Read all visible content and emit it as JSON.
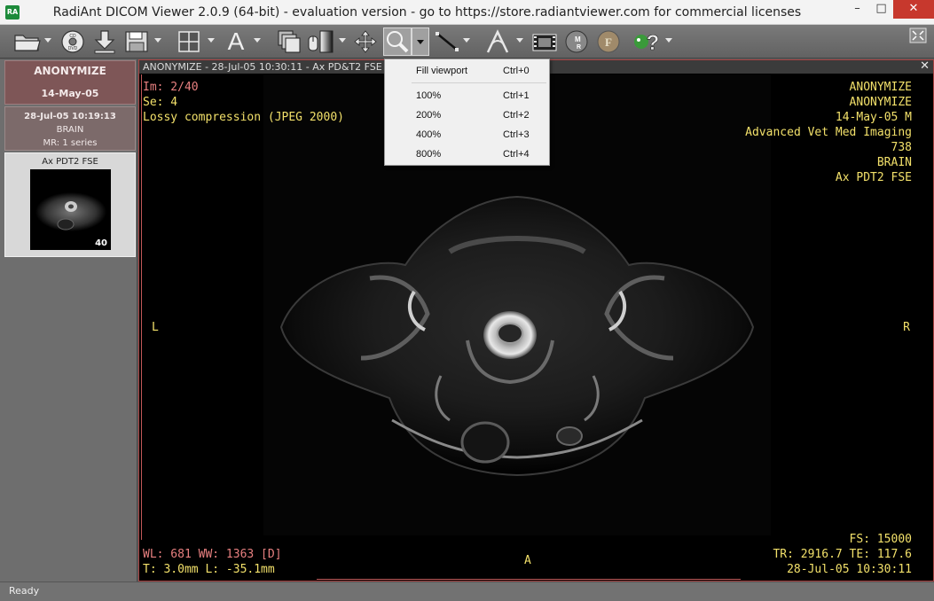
{
  "window": {
    "app_badge": "RA",
    "title": "RadiAnt DICOM Viewer 2.0.9 (64-bit) - evaluation version - go to https://store.radiantviewer.com for commercial licenses",
    "minimize": "–",
    "maximize": "□",
    "close": "✕"
  },
  "toolbar": {
    "buttons": [
      "open-folder",
      "open-cd",
      "download",
      "save",
      "layout",
      "annotate",
      "series",
      "window-level",
      "pan",
      "zoom",
      "measure",
      "3d",
      "cine",
      "mpr",
      "fusion",
      "help",
      "fullscreen"
    ],
    "text_tool_glyph": "A",
    "help_glyph": "?"
  },
  "patient": {
    "name": "ANONYMIZE",
    "date": "14-May-05"
  },
  "study": {
    "datetime": "28-Jul-05 10:19:13",
    "description": "BRAIN",
    "summary": "MR: 1 series"
  },
  "series": {
    "label": "Ax PDT2 FSE",
    "image_count": "40"
  },
  "viewer": {
    "header": "ANONYMIZE - 28-Jul-05 10:30:11 - Ax PD&T2 FSE",
    "close": "✕",
    "top_left": [
      "Im: 2/40",
      "Se: 4",
      "Lossy compression (JPEG 2000)"
    ],
    "top_right": [
      "ANONYMIZE",
      "ANONYMIZE",
      "14-May-05 M",
      "Advanced Vet Med Imaging",
      "738",
      "BRAIN",
      "Ax PDT2 FSE"
    ],
    "left_marker": "L",
    "right_marker": "R",
    "bottom_marker": "A",
    "bottom_left": {
      "window": "WL: 681 WW: 1363 [D]",
      "thickness": "T: 3.0mm L: -35.1mm"
    },
    "bottom_right": [
      "FS: 15000",
      "TR: 2916.7 TE: 117.6",
      "28-Jul-05 10:30:11"
    ]
  },
  "zoom_menu": {
    "items": [
      {
        "label": "Fill viewport",
        "shortcut": "Ctrl+0"
      },
      {
        "label": "100%",
        "shortcut": "Ctrl+1"
      },
      {
        "label": "200%",
        "shortcut": "Ctrl+2"
      },
      {
        "label": "400%",
        "shortcut": "Ctrl+3"
      },
      {
        "label": "800%",
        "shortcut": "Ctrl+4"
      }
    ]
  },
  "status": {
    "text": "Ready"
  }
}
